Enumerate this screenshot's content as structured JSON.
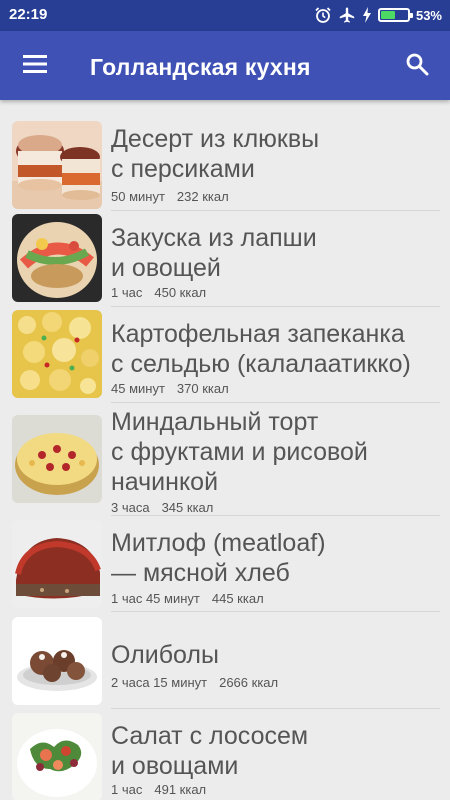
{
  "status_bar": {
    "time": "22:19",
    "battery_percent": "53%",
    "battery_level": 0.53
  },
  "app_bar": {
    "title": "Голландская кухня"
  },
  "recipes": [
    {
      "title_line1": "Десерт из клюквы",
      "title_line2": "с персиками",
      "title_line3": "",
      "time": "50 минут",
      "kcal": "232 ккал"
    },
    {
      "title_line1": "Закуска из лапши",
      "title_line2": "и овощей",
      "title_line3": "",
      "time": "1 час",
      "kcal": "450 ккал"
    },
    {
      "title_line1": "Картофельная запеканка",
      "title_line2": "с сельдью (калалаатикко)",
      "title_line3": "",
      "time": "45 минут",
      "kcal": "370 ккал"
    },
    {
      "title_line1": "Миндальный торт",
      "title_line2": "с фруктами и рисовой",
      "title_line3": "начинкой",
      "time": "3 часа",
      "kcal": "345 ккал"
    },
    {
      "title_line1": "Митлоф (meatloaf)",
      "title_line2": "— мясной хлеб",
      "title_line3": "",
      "time": "1 час 45 минут",
      "kcal": "445 ккал"
    },
    {
      "title_line1": "Олиболы",
      "title_line2": "",
      "title_line3": "",
      "time": "2 часа 15 минут",
      "kcal": "2666 ккал"
    },
    {
      "title_line1": "Салат с лососем",
      "title_line2": "и овощами",
      "title_line3": "",
      "time": "1 час",
      "kcal": "491 ккал"
    }
  ],
  "icons": {
    "menu": "menu-icon",
    "search": "search-icon",
    "alarm": "alarm-icon",
    "airplane": "airplane-icon",
    "charging": "charging-icon",
    "battery": "battery-icon"
  },
  "colors": {
    "status_bar": "#283e94",
    "app_bar": "#3f51b5",
    "background": "#ececec",
    "text": "#555555"
  }
}
